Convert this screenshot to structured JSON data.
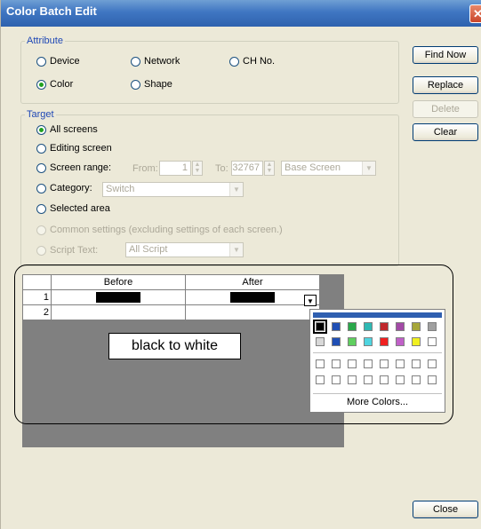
{
  "window": {
    "title": "Color Batch Edit",
    "close_glyph": "✕"
  },
  "attribute": {
    "legend": "Attribute",
    "options": [
      {
        "label": "Device",
        "selected": false
      },
      {
        "label": "Network",
        "selected": false
      },
      {
        "label": "CH No.",
        "selected": false
      },
      {
        "label": "Color",
        "selected": true
      },
      {
        "label": "Shape",
        "selected": false
      }
    ]
  },
  "target": {
    "legend": "Target",
    "all_screens": {
      "label": "All screens",
      "selected": true
    },
    "editing_screen": {
      "label": "Editing screen",
      "selected": false
    },
    "screen_range": {
      "label": "Screen range:",
      "selected": false,
      "from_label": "From:",
      "from_value": "1",
      "to_label": "To:",
      "to_value": "32767",
      "screen_type": "Base Screen"
    },
    "category": {
      "label": "Category:",
      "selected": false,
      "value": "Switch"
    },
    "selected_area": {
      "label": "Selected area",
      "selected": false
    },
    "common_settings": {
      "label": "Common settings (excluding settings of each screen.)",
      "enabled": false
    },
    "script_text": {
      "label": "Script Text:",
      "enabled": false,
      "value": "All Script"
    }
  },
  "buttons": {
    "find_now": "Find Now",
    "replace": "Replace",
    "delete": "Delete",
    "clear": "Clear",
    "close": "Close"
  },
  "grid": {
    "columns": [
      "Before",
      "After"
    ],
    "rows": [
      {
        "num": "1",
        "before": "#000000",
        "after": "#000000"
      },
      {
        "num": "2",
        "before": "",
        "after": ""
      }
    ]
  },
  "callout": "black to white",
  "palette": {
    "row1": [
      "#000000",
      "#1f4fb5",
      "#2aa84a",
      "#2fb9b4",
      "#c0282d",
      "#a34aa6",
      "#a6a63a",
      "#a0a0a0"
    ],
    "row2": [
      "#d8d8d8",
      "#1f4fb5",
      "#5fcf5f",
      "#4fd5e0",
      "#f02020",
      "#c060c8",
      "#f0f020",
      "#ffffff"
    ],
    "row3": [
      "#ffffff",
      "#ffffff",
      "#ffffff",
      "#ffffff",
      "#ffffff",
      "#ffffff",
      "#ffffff",
      "#ffffff"
    ],
    "row4": [
      "#ffffff",
      "#ffffff",
      "#ffffff",
      "#ffffff",
      "#ffffff",
      "#ffffff",
      "#ffffff",
      "#ffffff"
    ],
    "more_colors": "More Colors..."
  }
}
